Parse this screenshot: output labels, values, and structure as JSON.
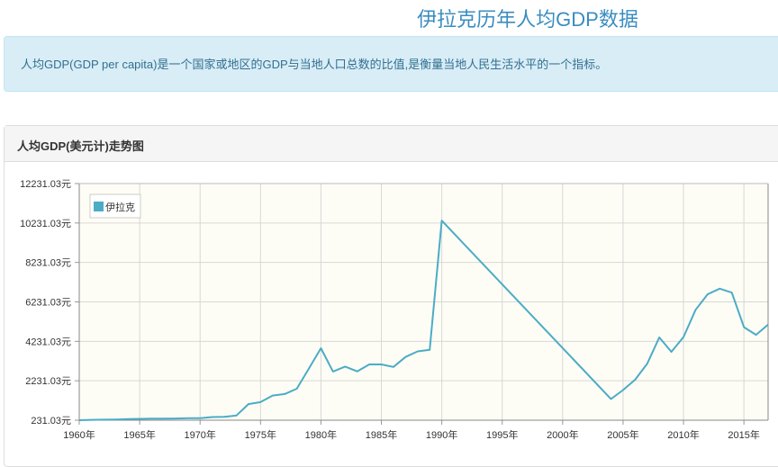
{
  "page": {
    "title": "伊拉克历年人均GDP数据",
    "intro": "人均GDP(GDP per capita)是一个国家或地区的GDP与当地人口总数的比值,是衡量当地人民生活水平的一个指标。",
    "panel_title": "人均GDP(美元计)走势图"
  },
  "colors": {
    "series": "#4bacc6",
    "plot_bg": "#fefdf5",
    "grid": "#d7d7d7"
  },
  "chart_data": {
    "type": "line",
    "xlim": [
      1960,
      2017
    ],
    "ylim": [
      231.03,
      12231.03
    ],
    "x_ticks": [
      1960,
      1965,
      1970,
      1975,
      1980,
      1985,
      1990,
      1995,
      2000,
      2005,
      2010,
      2015
    ],
    "x_tick_labels": [
      "1960年",
      "1965年",
      "1970年",
      "1975年",
      "1980年",
      "1985年",
      "1990年",
      "1995年",
      "2000年",
      "2005年",
      "2010年",
      "2015年"
    ],
    "y_ticks": [
      231.03,
      2231.03,
      4231.03,
      6231.03,
      8231.03,
      10231.03,
      12231.03
    ],
    "y_tick_labels": [
      "231.03元",
      "2231.03元",
      "4231.03元",
      "6231.03元",
      "8231.03元",
      "10231.03元",
      "12231.03元"
    ],
    "grid": true,
    "legend_position": "top-left",
    "series": [
      {
        "name": "伊拉克",
        "x": [
          1960,
          1961,
          1962,
          1963,
          1964,
          1965,
          1966,
          1967,
          1968,
          1969,
          1970,
          1971,
          1972,
          1973,
          1974,
          1975,
          1976,
          1977,
          1978,
          1979,
          1980,
          1981,
          1982,
          1983,
          1984,
          1985,
          1986,
          1987,
          1988,
          1989,
          1990,
          2004,
          2005,
          2006,
          2007,
          2008,
          2009,
          2010,
          2011,
          2012,
          2013,
          2014,
          2015,
          2016,
          2017
        ],
        "values": [
          231,
          250,
          260,
          265,
          290,
          300,
          310,
          315,
          320,
          330,
          335,
          390,
          400,
          470,
          1050,
          1150,
          1480,
          1560,
          1830,
          2850,
          3880,
          2700,
          2950,
          2710,
          3060,
          3060,
          2930,
          3440,
          3720,
          3800,
          10350,
          1310,
          1760,
          2290,
          3100,
          4430,
          3700,
          4450,
          5830,
          6620,
          6900,
          6700,
          4950,
          4560,
          5080
        ]
      }
    ]
  }
}
